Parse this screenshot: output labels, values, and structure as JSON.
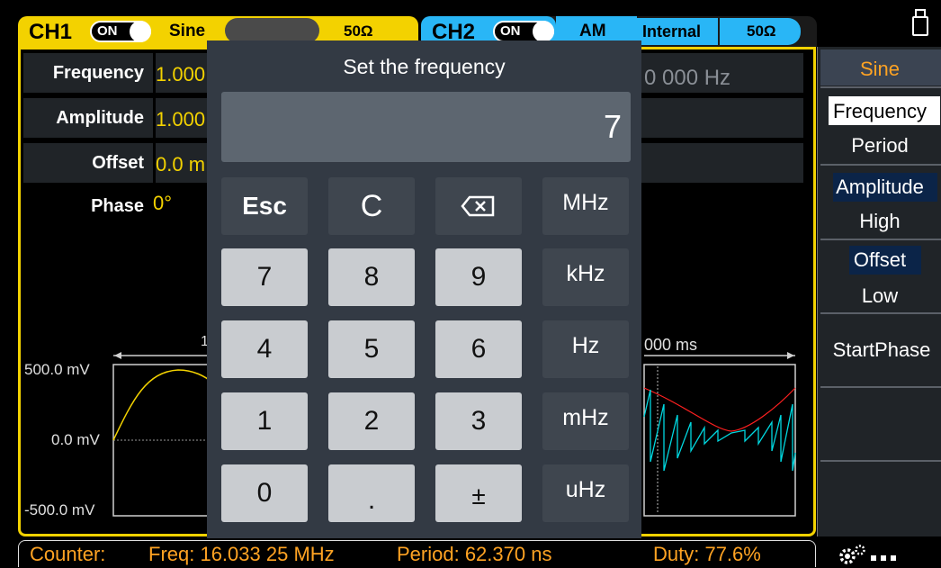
{
  "ch1": {
    "name": "CH1",
    "state": "ON",
    "wave": "Sine",
    "load": "50Ω"
  },
  "ch2": {
    "name": "CH2",
    "state": "ON",
    "mod": "AM",
    "source": "Internal",
    "load": "50Ω"
  },
  "params": [
    {
      "label": "Frequency",
      "value": "1.000"
    },
    {
      "label": "Amplitude",
      "value": "1.000"
    },
    {
      "label": "Offset",
      "value": "0.0 m"
    },
    {
      "label": "Phase",
      "value": "0°"
    }
  ],
  "ch2_freq_fragment": "0 000 Hz",
  "ch2_time_fragment": "000 ms",
  "waveform": {
    "y_labels": [
      "500.0 mV",
      "0.0 mV",
      "-500.0 mV"
    ],
    "cursor_fragment": "1"
  },
  "dialog": {
    "title": "Set the frequency",
    "entry": "7",
    "keys": {
      "esc": "Esc",
      "clear": "C",
      "backspace": "⌫",
      "digits": [
        "7",
        "8",
        "9",
        "4",
        "5",
        "6",
        "1",
        "2",
        "3",
        "0",
        ".",
        "±"
      ],
      "units": [
        "MHz",
        "kHz",
        "Hz",
        "mHz",
        "uHz"
      ]
    }
  },
  "side_menu": {
    "wave": "Sine",
    "items": [
      "Frequency",
      "Period",
      "Amplitude",
      "High",
      "Offset",
      "Low",
      "StartPhase"
    ]
  },
  "counter": {
    "label": "Counter:",
    "freq": "Freq: 16.033 25 MHz",
    "period": "Period: 62.370 ns",
    "duty": "Duty: 77.6%"
  },
  "colors": {
    "ch1": "#f3d200",
    "ch2": "#29b6f6",
    "counter": "#ffa323",
    "ch2_wave": "#00d8e0",
    "envelope": "#ff2020"
  },
  "icons": {
    "usb": "usb-icon",
    "settings": "gear-icon"
  }
}
